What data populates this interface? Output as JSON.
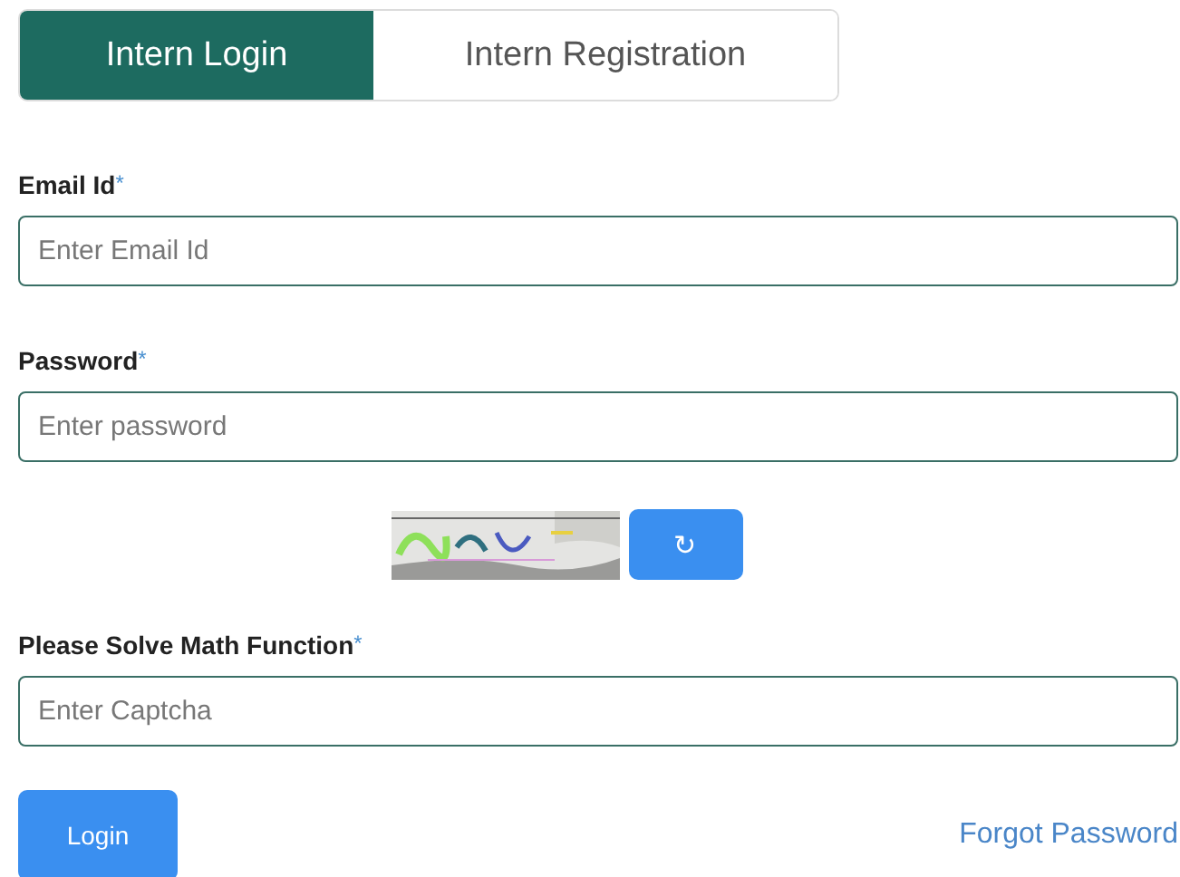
{
  "tabs": [
    {
      "label": "Intern Login",
      "selected": true
    },
    {
      "label": "Intern Registration",
      "selected": false
    }
  ],
  "fields": [
    {
      "label": "Email Id",
      "required_mark": "*",
      "placeholder": "Enter Email Id"
    },
    {
      "label": "Password",
      "required_mark": "*",
      "placeholder": "Enter password"
    }
  ],
  "captcha": {
    "refresh_button": "↻"
  },
  "captcha_field": {
    "label": "Please Solve Math Function",
    "required_mark": "*",
    "placeholder": "Enter Captcha"
  },
  "login_button": "Login",
  "forgot_password_link": "Forgot Password"
}
